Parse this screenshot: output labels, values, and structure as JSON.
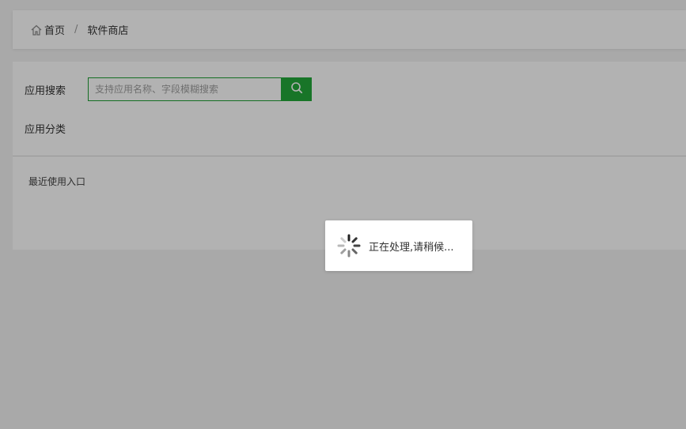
{
  "breadcrumb": {
    "home_label": "首页",
    "separator": "/",
    "current_label": "软件商店"
  },
  "search": {
    "label": "应用搜索",
    "placeholder": "支持应用名称、字段模糊搜索",
    "value": ""
  },
  "category": {
    "label": "应用分类"
  },
  "recent": {
    "label": "最近使用入口"
  },
  "loading": {
    "text": "正在处理,请稍候..."
  },
  "colors": {
    "accent": "#23a83a",
    "overlay": "rgba(0,0,0,0.3)"
  },
  "icons": {
    "home": "home-icon",
    "search": "search-icon",
    "spinner": "spinner-icon"
  }
}
